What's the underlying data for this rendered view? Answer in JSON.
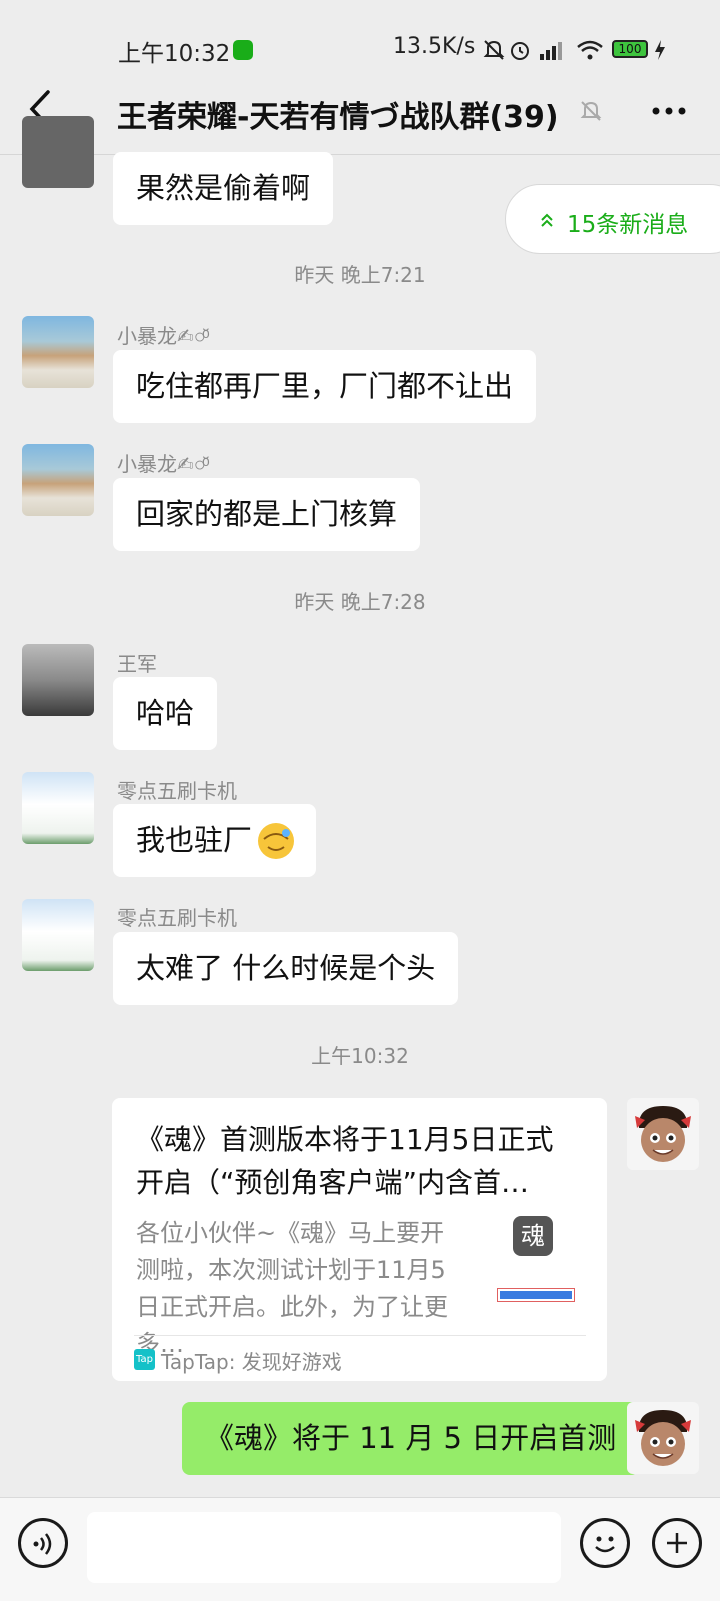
{
  "status_bar": {
    "time": "上午10:32",
    "network_speed": "13.5K/s",
    "battery": "100"
  },
  "header": {
    "title": "王者荣耀-天若有情づ战队群(39)"
  },
  "new_messages": {
    "label": "15条新消息"
  },
  "messages": [
    {
      "type": "text",
      "text": "果然是偷着啊"
    },
    {
      "type": "timestamp",
      "text": "昨天 晚上7:21"
    },
    {
      "type": "text",
      "sender": "小暴龙✍○ͦ̆",
      "text": "吃住都再厂里，厂门都不让出"
    },
    {
      "type": "text",
      "sender": "小暴龙✍○ͦ̆",
      "text": "回家的都是上门核算"
    },
    {
      "type": "timestamp",
      "text": "昨天 晚上7:28"
    },
    {
      "type": "text",
      "sender": "王军",
      "text": "哈哈"
    },
    {
      "type": "text",
      "sender": "零点五刷卡机",
      "text": "我也驻厂"
    },
    {
      "type": "text",
      "sender": "零点五刷卡机",
      "text": "太难了   什么时候是个头"
    },
    {
      "type": "timestamp",
      "text": "上午10:32"
    },
    {
      "type": "link_card",
      "title": "《魂》首测版本将于11月5日正式开启（“预创角客户端”内含首…",
      "description": "各位小伙伴~《魂》马上要开测啦，本次测试计划于11月5日正式开启。此外，为了让更多…",
      "source": "TapTap: 发现好游戏",
      "thumb_char": "魂",
      "tap_logo": "Tap"
    },
    {
      "type": "text",
      "own": true,
      "text": "《魂》将于 11 月 5 日开启首测"
    }
  ],
  "colors": {
    "background": "#ededed",
    "own_bubble": "#95ec69",
    "accent": "#1aad19"
  },
  "icons": [
    "back-arrow-icon",
    "mute-bell-icon",
    "more-icon",
    "voice-icon",
    "emoji-icon",
    "plus-icon"
  ]
}
